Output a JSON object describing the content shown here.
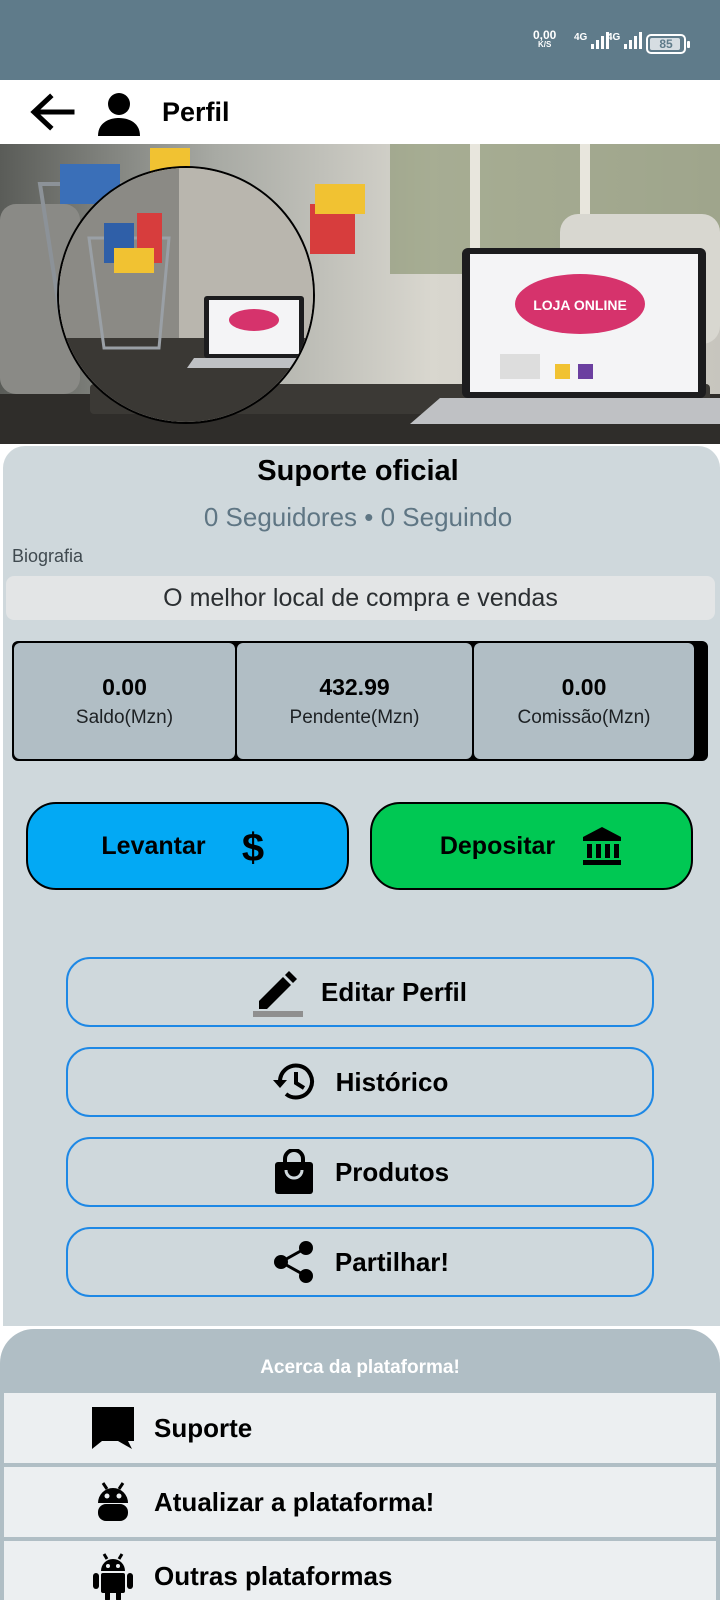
{
  "status_bar": {
    "net_speed": "0,00",
    "net_unit": "K/S",
    "sim1": "4G",
    "sim2": "4G",
    "battery": "85"
  },
  "appbar": {
    "title": "Perfil",
    "back_icon": "arrow-back-icon",
    "profile_icon": "person-icon"
  },
  "cover": {
    "laptop_screen_text": "LOJA ONLINE"
  },
  "profile": {
    "name": "Suporte oficial",
    "followers": "0 Seguidores • 0 Seguindo",
    "bio_label": "Biografia",
    "bio": "O melhor local de compra e vendas"
  },
  "stats": [
    {
      "value": "0.00",
      "label": "Saldo(Mzn)"
    },
    {
      "value": "432.99",
      "label": "Pendente(Mzn)"
    },
    {
      "value": "0.00",
      "label": "Comissão(Mzn)"
    }
  ],
  "actions": {
    "withdraw": {
      "label": "Levantar",
      "icon": "dollar-icon",
      "color": "#03a9f4"
    },
    "deposit": {
      "label": "Depositar",
      "icon": "bank-icon",
      "color": "#00c853"
    }
  },
  "menu": [
    {
      "label": "Editar Perfil",
      "icon": "edit-icon"
    },
    {
      "label": "Histórico",
      "icon": "history-icon"
    },
    {
      "label": "Produtos",
      "icon": "shopping-bag-icon"
    },
    {
      "label": "Partilhar!",
      "icon": "share-icon"
    }
  ],
  "about": {
    "title": "Acerca da plataforma!",
    "items": [
      {
        "label": "Suporte",
        "icon": "chat-icon"
      },
      {
        "label": "Atualizar a plataforma!",
        "icon": "android-icon"
      },
      {
        "label": "Outras plataformas",
        "icon": "android-icon"
      }
    ]
  },
  "colors": {
    "status_bar": "#5f7b8a",
    "card": "#cfd8dc",
    "about": "#b0bec5",
    "outline": "#1e88e5"
  }
}
